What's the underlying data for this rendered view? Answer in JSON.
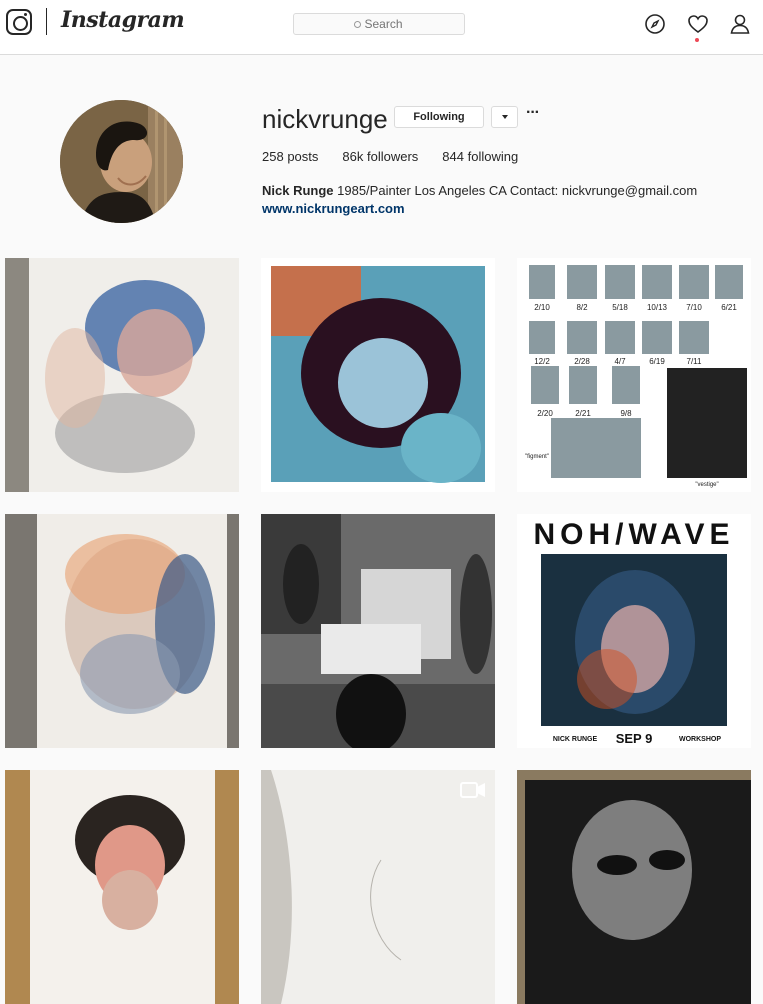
{
  "header": {
    "wordmark": "Instagram",
    "search_placeholder": "Search",
    "icons": [
      "instagram-camera-icon",
      "explore-compass-icon",
      "activity-heart-icon",
      "profile-person-icon"
    ],
    "notification_color": "#ed4956"
  },
  "profile": {
    "username": "nickvrunge",
    "follow_label": "Following",
    "more_label": "···",
    "stats": {
      "posts_count": "258",
      "posts_label": "posts",
      "followers_count": "86k",
      "followers_label": "followers",
      "following_count": "844",
      "following_label": "following"
    },
    "full_name": "Nick Runge",
    "bio": "1985/Painter Los Angeles CA Contact: nickvrunge@gmail.com",
    "website": "www.nickrungeart.com"
  },
  "posts": {
    "post3_labels": [
      "2/10",
      "8/2",
      "5/18",
      "10/13",
      "7/10",
      "6/21",
      "12/2",
      "2/28",
      "4/7",
      "6/19",
      "7/11",
      "2/20",
      "2/21",
      "9/8",
      "\"figment\"",
      "\"vestige\""
    ],
    "post6": {
      "title": "NOH/WAVE",
      "artist": "NICK RUNGE",
      "date": "SEP 9",
      "event": "WORKSHOP"
    }
  }
}
